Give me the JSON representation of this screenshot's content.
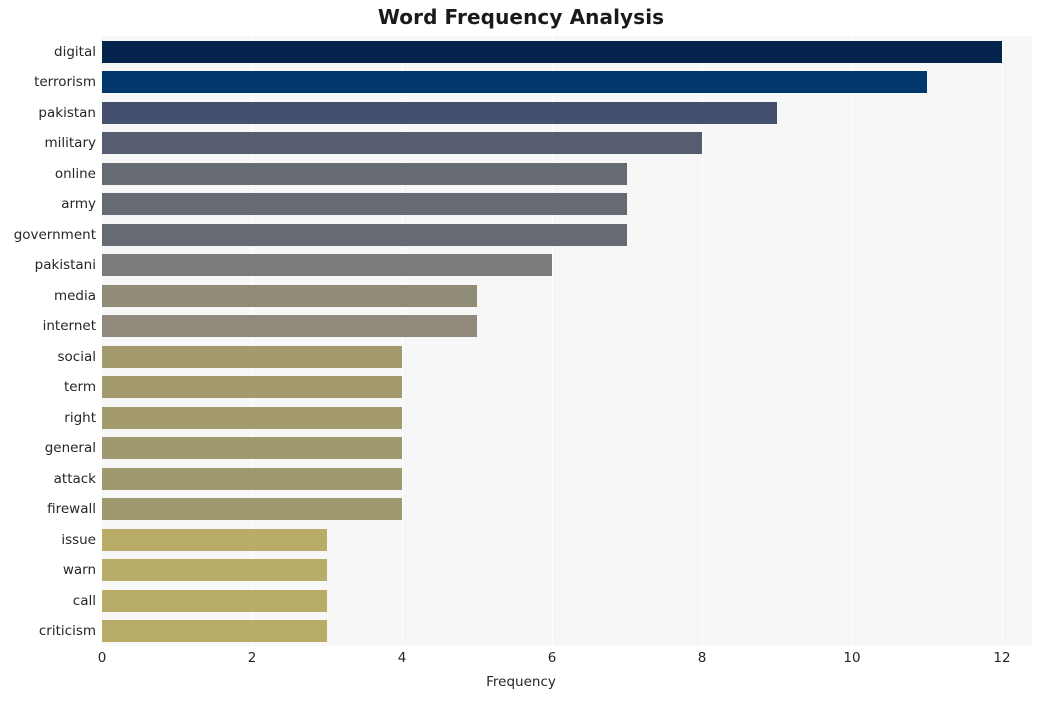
{
  "chart_data": {
    "type": "bar",
    "orientation": "horizontal",
    "title": "Word Frequency Analysis",
    "xlabel": "Frequency",
    "ylabel": "",
    "xlim": [
      0,
      12.4
    ],
    "ylim": [
      0,
      20
    ],
    "grid": true,
    "gridlines": "vertical",
    "legend": "none",
    "xticks": [
      0,
      2,
      4,
      6,
      8,
      10,
      12
    ],
    "xticklabels": [
      "0",
      "2",
      "4",
      "6",
      "8",
      "10",
      "12"
    ],
    "categories": [
      "digital",
      "terrorism",
      "pakistan",
      "military",
      "online",
      "army",
      "government",
      "pakistani",
      "media",
      "internet",
      "social",
      "term",
      "right",
      "general",
      "attack",
      "firewall",
      "issue",
      "warn",
      "call",
      "criticism"
    ],
    "values": [
      12,
      11,
      9,
      8,
      7,
      7,
      7,
      6,
      5,
      5,
      4,
      4,
      4,
      4,
      4,
      4,
      3,
      3,
      3,
      3
    ],
    "bar_colors": [
      "#04244d",
      "#03386f",
      "#44506e",
      "#575d70",
      "#666a73",
      "#666a73",
      "#666a73",
      "#7b7b79",
      "#8f8b75",
      "#918a7c",
      "#a39a6e",
      "#a39a6e",
      "#a39a6e",
      "#9f996f",
      "#9f996f",
      "#9f996f",
      "#b8ac68",
      "#b8ac68",
      "#b8ac68",
      "#b8ac68"
    ],
    "plot_background": "#f7f7f7",
    "figure_background": "#ffffff",
    "gridline_color": "#ffffff",
    "text_color": "#262626"
  }
}
